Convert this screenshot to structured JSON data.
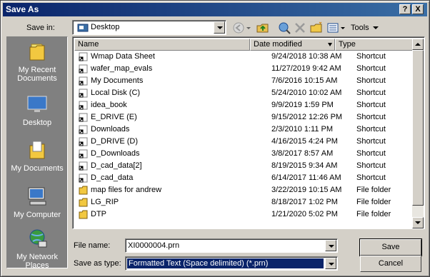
{
  "window": {
    "title": "Save As",
    "help_btn": "?",
    "close_btn": "X"
  },
  "toolbar": {
    "save_in_label": "Save in:",
    "save_in_value": "Desktop",
    "tools_label": "Tools"
  },
  "places": [
    {
      "label": "My Recent Documents",
      "icon": "recent-docs-icon"
    },
    {
      "label": "Desktop",
      "icon": "desktop-icon"
    },
    {
      "label": "My Documents",
      "icon": "my-documents-icon"
    },
    {
      "label": "My Computer",
      "icon": "my-computer-icon"
    },
    {
      "label": "My Network Places",
      "icon": "network-places-icon"
    }
  ],
  "columns": {
    "name": "Name",
    "date": "Date modified",
    "type": "Type"
  },
  "files": [
    {
      "name": "Wmap Data Sheet",
      "date": "9/24/2018 10:38 AM",
      "type": "Shortcut",
      "kind": "shortcut"
    },
    {
      "name": "wafer_map_evals",
      "date": "11/27/2019 9:42 AM",
      "type": "Shortcut",
      "kind": "shortcut"
    },
    {
      "name": "My Documents",
      "date": "7/6/2016 10:15 AM",
      "type": "Shortcut",
      "kind": "shortcut"
    },
    {
      "name": "Local Disk (C)",
      "date": "5/24/2010 10:02 AM",
      "type": "Shortcut",
      "kind": "shortcut"
    },
    {
      "name": "idea_book",
      "date": "9/9/2019 1:59 PM",
      "type": "Shortcut",
      "kind": "shortcut"
    },
    {
      "name": "E_DRIVE (E)",
      "date": "9/15/2012 12:26 PM",
      "type": "Shortcut",
      "kind": "shortcut"
    },
    {
      "name": "Downloads",
      "date": "2/3/2010 1:11 PM",
      "type": "Shortcut",
      "kind": "shortcut"
    },
    {
      "name": "D_DRIVE (D)",
      "date": "4/16/2015 4:24 PM",
      "type": "Shortcut",
      "kind": "shortcut"
    },
    {
      "name": "D_Downloads",
      "date": "3/8/2017 8:57 AM",
      "type": "Shortcut",
      "kind": "shortcut"
    },
    {
      "name": "D_cad_data[2]",
      "date": "8/19/2015 9:34 AM",
      "type": "Shortcut",
      "kind": "shortcut"
    },
    {
      "name": "D_cad_data",
      "date": "6/14/2017 11:46 AM",
      "type": "Shortcut",
      "kind": "shortcut"
    },
    {
      "name": "map files for andrew",
      "date": "3/22/2019 10:15 AM",
      "type": "File folder",
      "kind": "folder"
    },
    {
      "name": "LG_RIP",
      "date": "8/18/2017 1:02 PM",
      "type": "File folder",
      "kind": "folder"
    },
    {
      "name": "DTP",
      "date": "1/21/2020 5:02 PM",
      "type": "File folder",
      "kind": "folder"
    }
  ],
  "form": {
    "filename_label": "File name:",
    "filename_value": "XI0000004.prn",
    "type_label": "Save as type:",
    "type_value": "Formatted Text (Space delimited) (*.prn)"
  },
  "buttons": {
    "save": "Save",
    "cancel": "Cancel"
  },
  "colors": {
    "title_bar": "#0a246a",
    "selection": "#0a246a",
    "face": "#d4d0c8"
  }
}
